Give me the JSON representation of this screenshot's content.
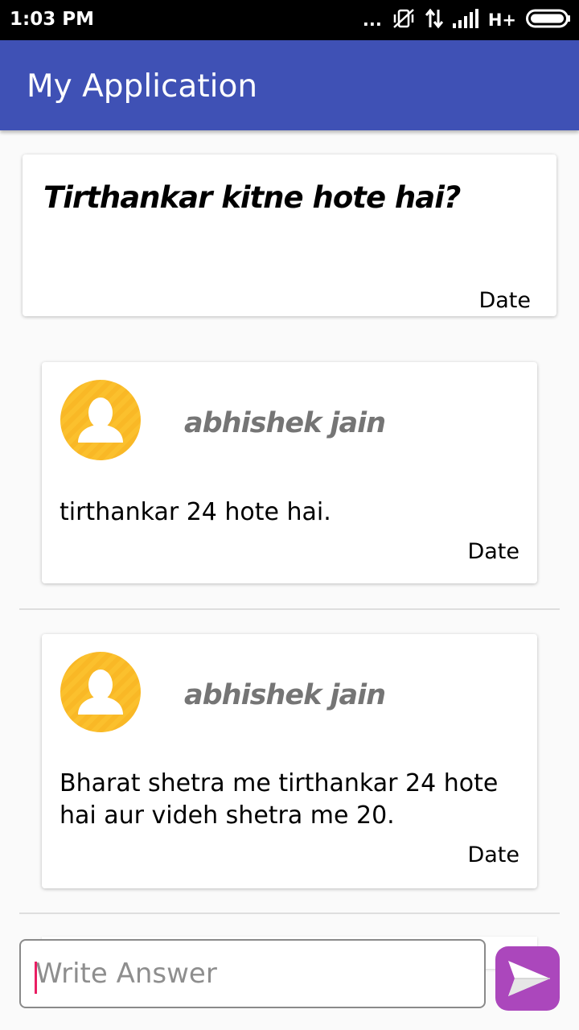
{
  "status_bar": {
    "time": "1:03 PM",
    "dots": "...",
    "network": "H+",
    "icons": [
      "more-icon",
      "silent-vibrate-icon",
      "data-transfer-icon",
      "signal-icon",
      "network-type-icon",
      "battery-icon"
    ]
  },
  "app_bar": {
    "title": "My Application",
    "color": "#3f51b5"
  },
  "question": {
    "text": "Tirthankar kitne hote hai?",
    "date": "Date"
  },
  "answers": [
    {
      "author": "abhishek jain",
      "text": "tirthankar 24 hote hai.",
      "date": "Date",
      "avatar_icon": "user-avatar-icon"
    },
    {
      "author": "abhishek jain",
      "text": "Bharat shetra me tirthankar 24 hote hai aur videh shetra me 20.",
      "date": "Date",
      "avatar_icon": "user-avatar-icon"
    }
  ],
  "composer": {
    "placeholder": "Write Answer",
    "value": "",
    "send_icon": "send-icon",
    "send_color": "#ab47bc"
  },
  "colors": {
    "avatar": "#fbc02d",
    "accent": "#e91e63"
  }
}
